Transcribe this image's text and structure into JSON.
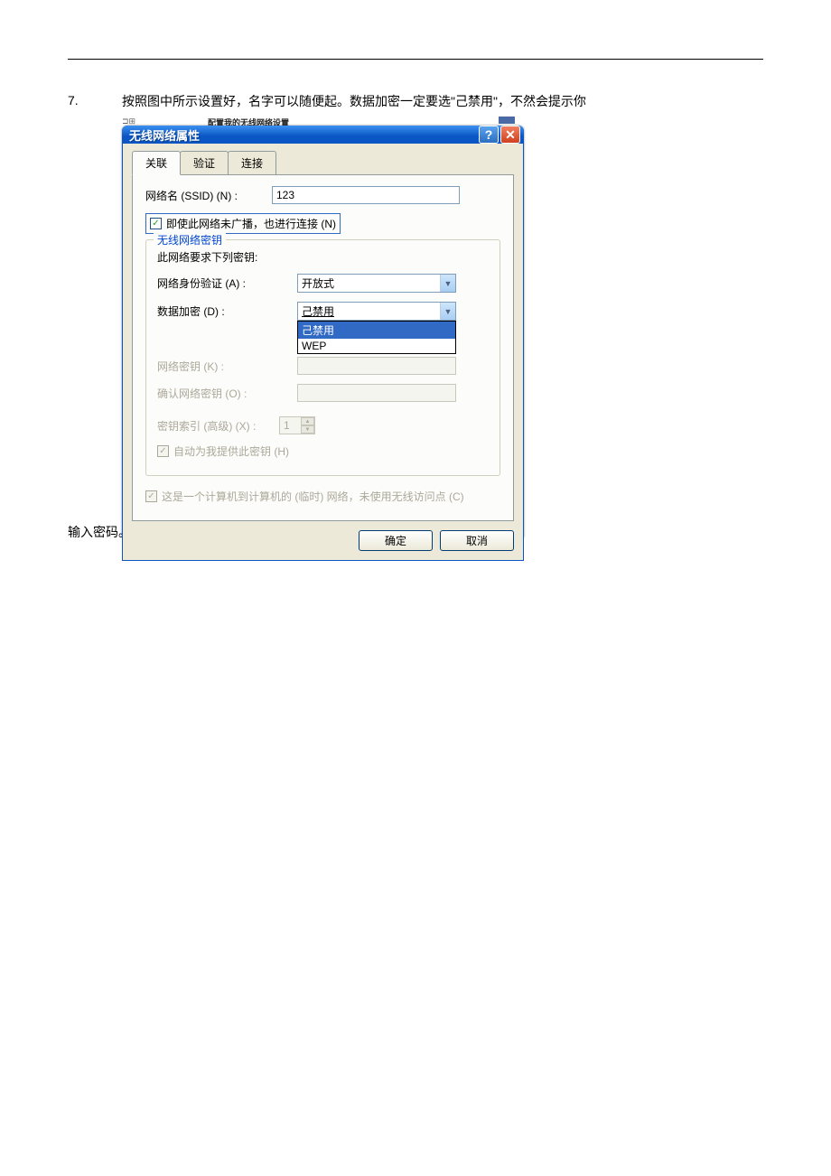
{
  "doc": {
    "list_number": "7.",
    "instruction": "按照图中所示设置好，名字可以随便起。数据加密一定要选\"己禁用\"，不然会提示你",
    "trailing": "输入密码。"
  },
  "dialog": {
    "title": "无线网络属性",
    "tabs": {
      "t1": "关联",
      "t2": "验证",
      "t3": "连接"
    },
    "ssid_label": "网络名 (SSID) (N) :",
    "ssid_value": "123",
    "broadcast_cb": "即使此网络未广播，也进行连接 (N)",
    "keygroup": {
      "legend": "无线网络密钥",
      "msg": "此网络要求下列密钥:",
      "auth_label": "网络身份验证 (A) :",
      "auth_value": "开放式",
      "enc_label": "数据加密 (D) :",
      "enc_value": "己禁用",
      "enc_opt1": "己禁用",
      "enc_opt2": "WEP",
      "key_label": "网络密钥 (K) :",
      "confirm_label": "确认网络密钥 (O) :",
      "index_label": "密钥索引 (高级) (X) :",
      "index_value": "1",
      "autokey_cb": "自动为我提供此密钥 (H)"
    },
    "adhoc_cb": "这是一个计算机到计算机的 (临时) 网络，未使用无线访问点 (C)",
    "ok_btn": "确定",
    "cancel_btn": "取消"
  }
}
